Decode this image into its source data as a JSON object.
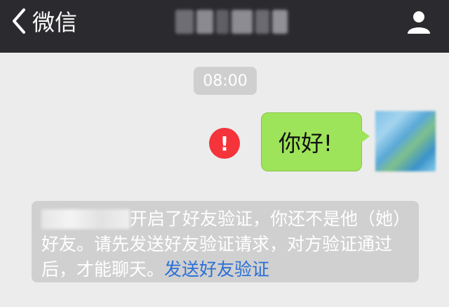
{
  "header": {
    "back_label": "微信",
    "title": ""
  },
  "chat": {
    "time": "08:00",
    "message": "你好!",
    "system_text_before_link": "开启了好友验证，你还不是他（她）好友。请先发送好友验证请求，对方验证通过后，才能聊天。",
    "system_link": "发送好友验证"
  },
  "colors": {
    "topbar": "#2b2b2f",
    "bubble": "#9ee45a",
    "alert": "#f4333a",
    "link": "#2b6fd6"
  },
  "icons": {
    "back": "chevron-left-icon",
    "profile": "person-icon",
    "alert": "exclamation-icon"
  }
}
